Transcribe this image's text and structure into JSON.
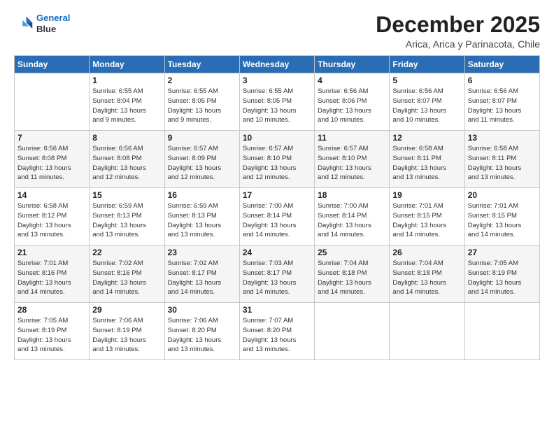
{
  "logo": {
    "line1": "General",
    "line2": "Blue"
  },
  "title": "December 2025",
  "subtitle": "Arica, Arica y Parinacota, Chile",
  "days_of_week": [
    "Sunday",
    "Monday",
    "Tuesday",
    "Wednesday",
    "Thursday",
    "Friday",
    "Saturday"
  ],
  "weeks": [
    [
      {
        "day": "",
        "info": ""
      },
      {
        "day": "1",
        "info": "Sunrise: 6:55 AM\nSunset: 8:04 PM\nDaylight: 13 hours\nand 9 minutes."
      },
      {
        "day": "2",
        "info": "Sunrise: 6:55 AM\nSunset: 8:05 PM\nDaylight: 13 hours\nand 9 minutes."
      },
      {
        "day": "3",
        "info": "Sunrise: 6:55 AM\nSunset: 8:05 PM\nDaylight: 13 hours\nand 10 minutes."
      },
      {
        "day": "4",
        "info": "Sunrise: 6:56 AM\nSunset: 8:06 PM\nDaylight: 13 hours\nand 10 minutes."
      },
      {
        "day": "5",
        "info": "Sunrise: 6:56 AM\nSunset: 8:07 PM\nDaylight: 13 hours\nand 10 minutes."
      },
      {
        "day": "6",
        "info": "Sunrise: 6:56 AM\nSunset: 8:07 PM\nDaylight: 13 hours\nand 11 minutes."
      }
    ],
    [
      {
        "day": "7",
        "info": "Sunrise: 6:56 AM\nSunset: 8:08 PM\nDaylight: 13 hours\nand 11 minutes."
      },
      {
        "day": "8",
        "info": "Sunrise: 6:56 AM\nSunset: 8:08 PM\nDaylight: 13 hours\nand 12 minutes."
      },
      {
        "day": "9",
        "info": "Sunrise: 6:57 AM\nSunset: 8:09 PM\nDaylight: 13 hours\nand 12 minutes."
      },
      {
        "day": "10",
        "info": "Sunrise: 6:57 AM\nSunset: 8:10 PM\nDaylight: 13 hours\nand 12 minutes."
      },
      {
        "day": "11",
        "info": "Sunrise: 6:57 AM\nSunset: 8:10 PM\nDaylight: 13 hours\nand 12 minutes."
      },
      {
        "day": "12",
        "info": "Sunrise: 6:58 AM\nSunset: 8:11 PM\nDaylight: 13 hours\nand 13 minutes."
      },
      {
        "day": "13",
        "info": "Sunrise: 6:58 AM\nSunset: 8:11 PM\nDaylight: 13 hours\nand 13 minutes."
      }
    ],
    [
      {
        "day": "14",
        "info": "Sunrise: 6:58 AM\nSunset: 8:12 PM\nDaylight: 13 hours\nand 13 minutes."
      },
      {
        "day": "15",
        "info": "Sunrise: 6:59 AM\nSunset: 8:13 PM\nDaylight: 13 hours\nand 13 minutes."
      },
      {
        "day": "16",
        "info": "Sunrise: 6:59 AM\nSunset: 8:13 PM\nDaylight: 13 hours\nand 13 minutes."
      },
      {
        "day": "17",
        "info": "Sunrise: 7:00 AM\nSunset: 8:14 PM\nDaylight: 13 hours\nand 14 minutes."
      },
      {
        "day": "18",
        "info": "Sunrise: 7:00 AM\nSunset: 8:14 PM\nDaylight: 13 hours\nand 14 minutes."
      },
      {
        "day": "19",
        "info": "Sunrise: 7:01 AM\nSunset: 8:15 PM\nDaylight: 13 hours\nand 14 minutes."
      },
      {
        "day": "20",
        "info": "Sunrise: 7:01 AM\nSunset: 8:15 PM\nDaylight: 13 hours\nand 14 minutes."
      }
    ],
    [
      {
        "day": "21",
        "info": "Sunrise: 7:01 AM\nSunset: 8:16 PM\nDaylight: 13 hours\nand 14 minutes."
      },
      {
        "day": "22",
        "info": "Sunrise: 7:02 AM\nSunset: 8:16 PM\nDaylight: 13 hours\nand 14 minutes."
      },
      {
        "day": "23",
        "info": "Sunrise: 7:02 AM\nSunset: 8:17 PM\nDaylight: 13 hours\nand 14 minutes."
      },
      {
        "day": "24",
        "info": "Sunrise: 7:03 AM\nSunset: 8:17 PM\nDaylight: 13 hours\nand 14 minutes."
      },
      {
        "day": "25",
        "info": "Sunrise: 7:04 AM\nSunset: 8:18 PM\nDaylight: 13 hours\nand 14 minutes."
      },
      {
        "day": "26",
        "info": "Sunrise: 7:04 AM\nSunset: 8:18 PM\nDaylight: 13 hours\nand 14 minutes."
      },
      {
        "day": "27",
        "info": "Sunrise: 7:05 AM\nSunset: 8:19 PM\nDaylight: 13 hours\nand 14 minutes."
      }
    ],
    [
      {
        "day": "28",
        "info": "Sunrise: 7:05 AM\nSunset: 8:19 PM\nDaylight: 13 hours\nand 13 minutes."
      },
      {
        "day": "29",
        "info": "Sunrise: 7:06 AM\nSunset: 8:19 PM\nDaylight: 13 hours\nand 13 minutes."
      },
      {
        "day": "30",
        "info": "Sunrise: 7:06 AM\nSunset: 8:20 PM\nDaylight: 13 hours\nand 13 minutes."
      },
      {
        "day": "31",
        "info": "Sunrise: 7:07 AM\nSunset: 8:20 PM\nDaylight: 13 hours\nand 13 minutes."
      },
      {
        "day": "",
        "info": ""
      },
      {
        "day": "",
        "info": ""
      },
      {
        "day": "",
        "info": ""
      }
    ]
  ]
}
